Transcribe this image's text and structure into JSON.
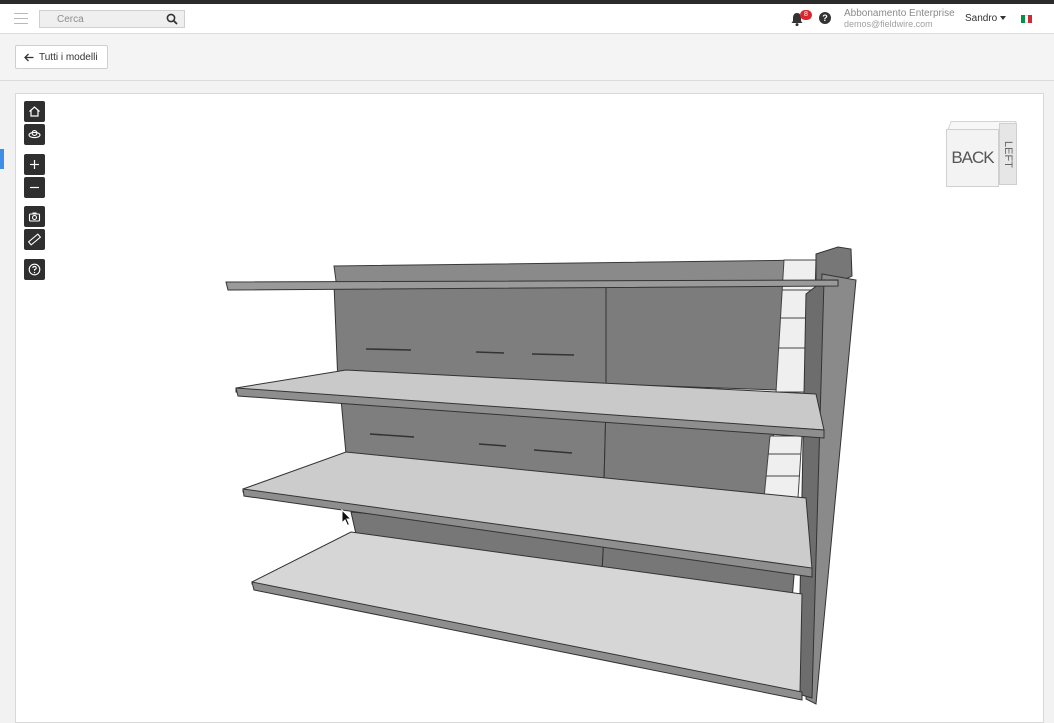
{
  "header": {
    "search_placeholder": "Cerca",
    "notification_count": "8",
    "help_label": "?",
    "subscription_title": "Abbonamento Enterprise",
    "subscription_email": "demos@fieldwire.com",
    "user_name": "Sandro",
    "language_flag": "it"
  },
  "toolbar": {
    "back_label": "Tutti i modelli"
  },
  "viewer": {
    "tools": [
      "home-icon",
      "orbit-icon",
      "zoom-in-icon",
      "zoom-out-icon",
      "camera-icon",
      "measure-icon",
      "help-icon"
    ],
    "viewcube": {
      "front_label": "BACK",
      "side_label": "LEFT"
    }
  },
  "colors": {
    "accent": "#3d8ee8",
    "badge": "#d9272d",
    "tool_bg": "#2f2f2f",
    "flag_green": "#009246",
    "flag_white": "#ffffff",
    "flag_red": "#ce2b37"
  }
}
